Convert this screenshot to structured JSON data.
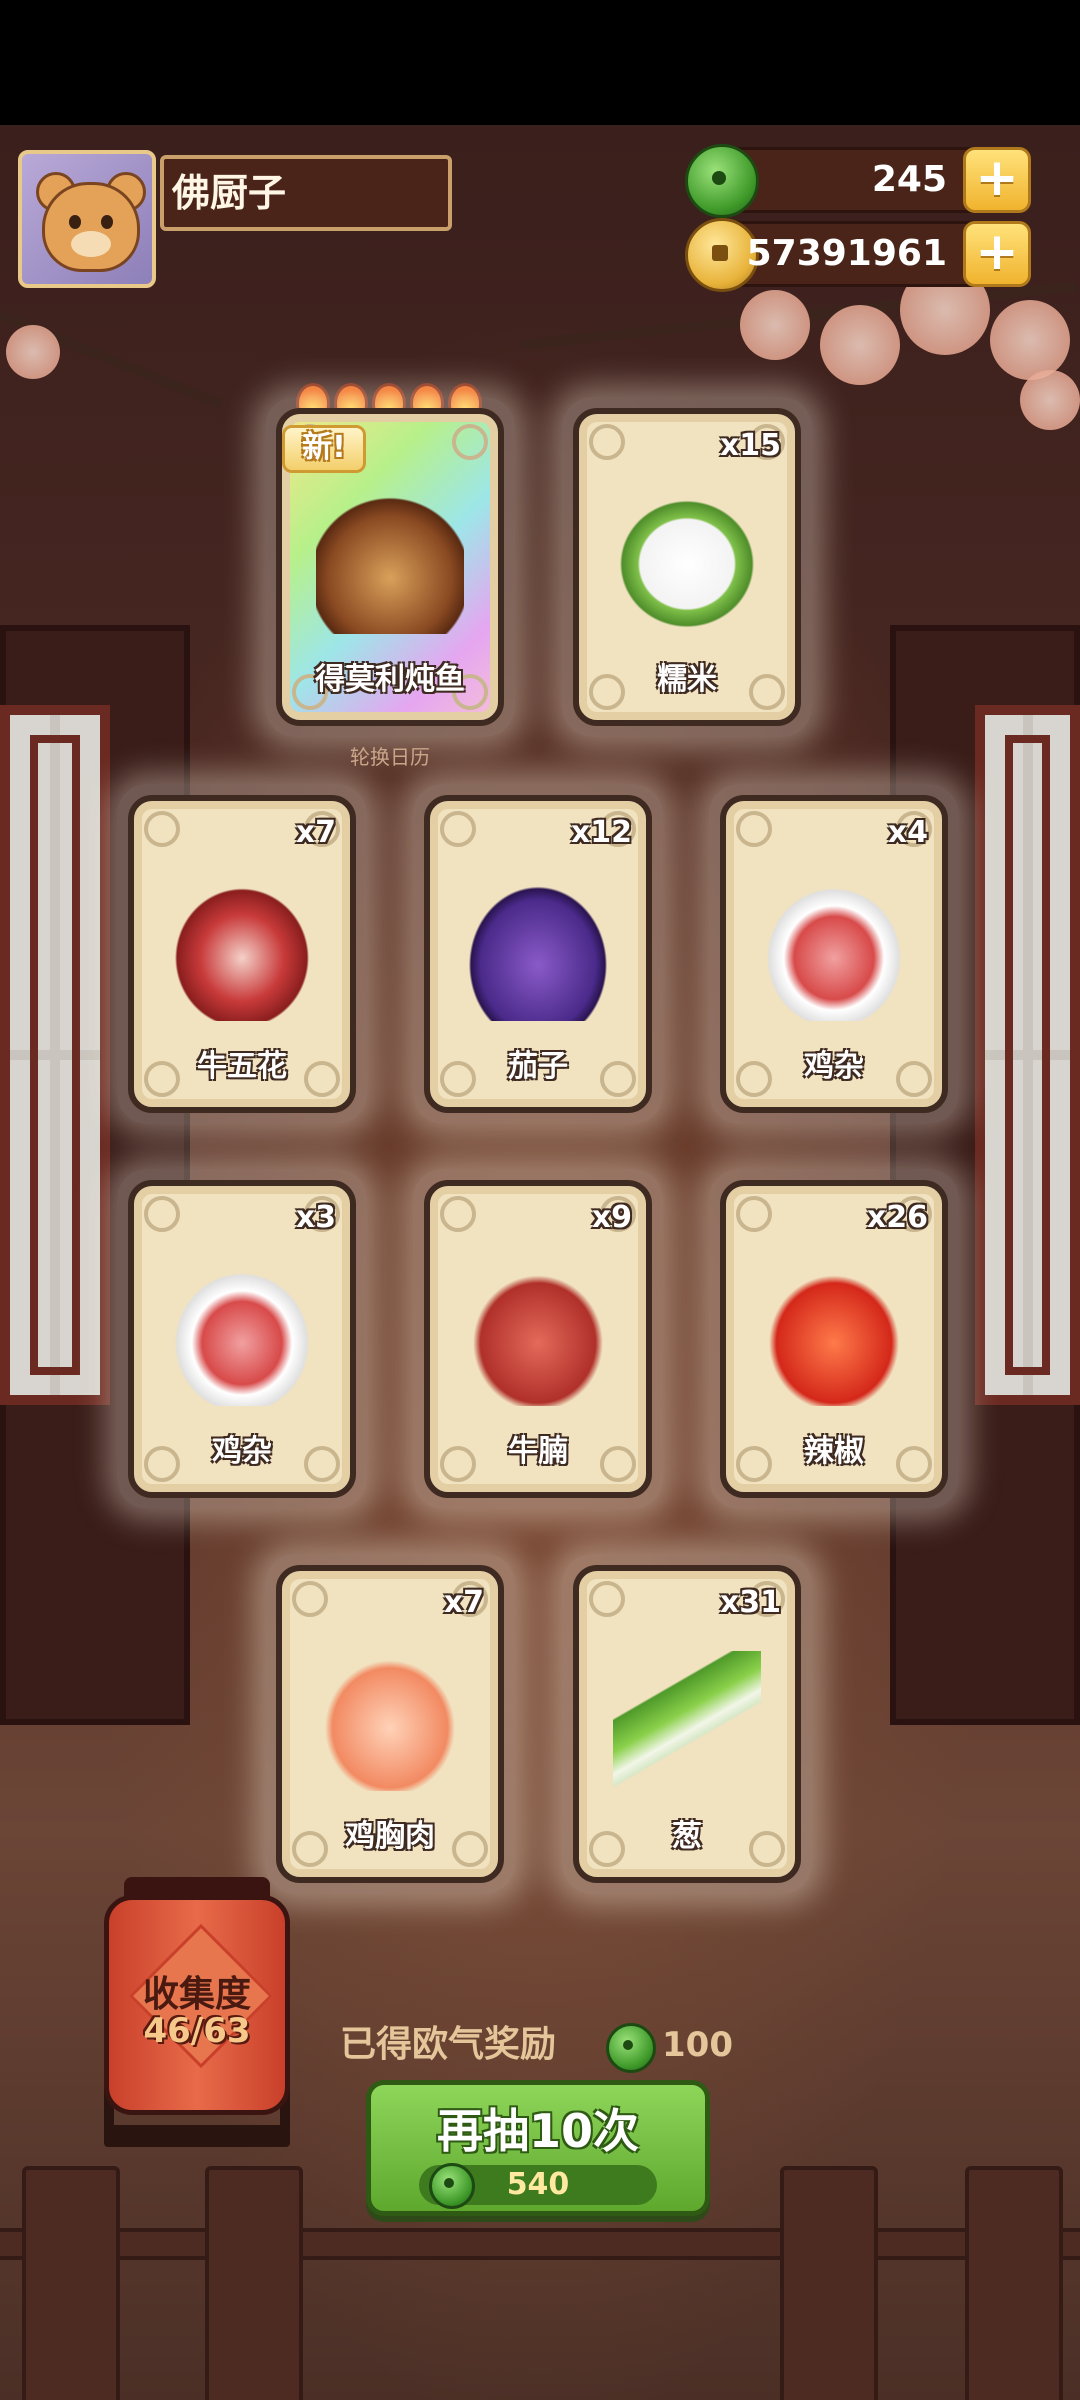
{
  "player": {
    "name": "佛厨子"
  },
  "currencies": {
    "jade": {
      "amount": "245",
      "icon": "jade-icon",
      "add": "+"
    },
    "coins": {
      "amount": "57391961",
      "icon": "coin-icon",
      "add": "+"
    }
  },
  "featured": {
    "new_badge": "新!",
    "stars": 5,
    "calendar_label": "轮换日历"
  },
  "cards": [
    {
      "name": "得莫利炖鱼",
      "qty": "",
      "icon": "braised-fish-icon",
      "rarity": "special"
    },
    {
      "name": "糯米",
      "qty": "x15",
      "icon": "glutinous-rice-icon"
    },
    {
      "name": "牛五花",
      "qty": "x7",
      "icon": "beef-brisket-icon"
    },
    {
      "name": "茄子",
      "qty": "x12",
      "icon": "eggplant-icon"
    },
    {
      "name": "鸡杂",
      "qty": "x4",
      "icon": "chicken-giblets-icon"
    },
    {
      "name": "鸡杂",
      "qty": "x3",
      "icon": "chicken-giblets-icon"
    },
    {
      "name": "牛腩",
      "qty": "x9",
      "icon": "beef-flank-icon"
    },
    {
      "name": "辣椒",
      "qty": "x26",
      "icon": "chili-pepper-icon"
    },
    {
      "name": "鸡胸肉",
      "qty": "x7",
      "icon": "chicken-breast-icon"
    },
    {
      "name": "葱",
      "qty": "x31",
      "icon": "scallion-icon"
    }
  ],
  "collection": {
    "title": "收集度",
    "count": "46/63"
  },
  "luck_reward": {
    "label": "已得欧气奖励",
    "value": "100"
  },
  "draw_again": {
    "label": "再抽10次",
    "cost": "540"
  },
  "colors": {
    "accent_green": "#5ea82e",
    "gold": "#f0b32e",
    "card_bg": "#f1e2c0",
    "wood": "#4a2418"
  }
}
